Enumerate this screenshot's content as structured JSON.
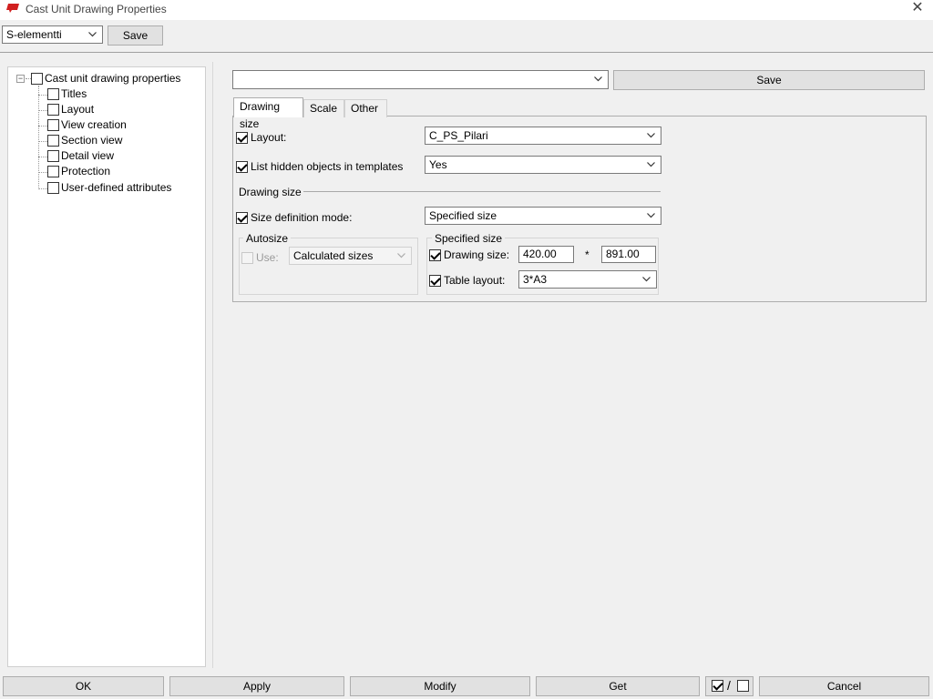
{
  "window": {
    "title": "Cast Unit Drawing Properties",
    "close_icon": "close-icon"
  },
  "top_bar": {
    "preset_value": "S-elementti",
    "save_label": "Save"
  },
  "tree": {
    "root": "Cast unit drawing properties",
    "collapse_symbol": "−",
    "items": [
      "Titles",
      "Layout",
      "View creation",
      "Section view",
      "Detail view",
      "Protection",
      "User-defined attributes"
    ]
  },
  "right_top": {
    "preset_value": "",
    "save_label": "Save"
  },
  "tabs": [
    {
      "label": "Drawing size"
    },
    {
      "label": "Scale"
    },
    {
      "label": "Other"
    }
  ],
  "drawing_size_tab": {
    "layout_label": "Layout:",
    "layout_value": "C_PS_Pilari",
    "hidden_label": "List hidden objects in templates",
    "hidden_value": "Yes",
    "section_title": "Drawing size",
    "size_mode_label": "Size definition mode:",
    "size_mode_value": "Specified size",
    "autosize": {
      "title": "Autosize",
      "use_label": "Use:",
      "use_value": "Calculated sizes"
    },
    "specified": {
      "title": "Specified size",
      "drawing_size_label": "Drawing size:",
      "width": "420.00",
      "separator": "*",
      "height": "891.00",
      "table_layout_label": "Table layout:",
      "table_layout_value": "3*A3"
    }
  },
  "bottom": {
    "ok": "OK",
    "apply": "Apply",
    "modify": "Modify",
    "get": "Get",
    "toggle_sep": "/",
    "cancel": "Cancel"
  },
  "colors": {
    "app_icon": "#d11f1f",
    "background": "#f0f0f0"
  }
}
